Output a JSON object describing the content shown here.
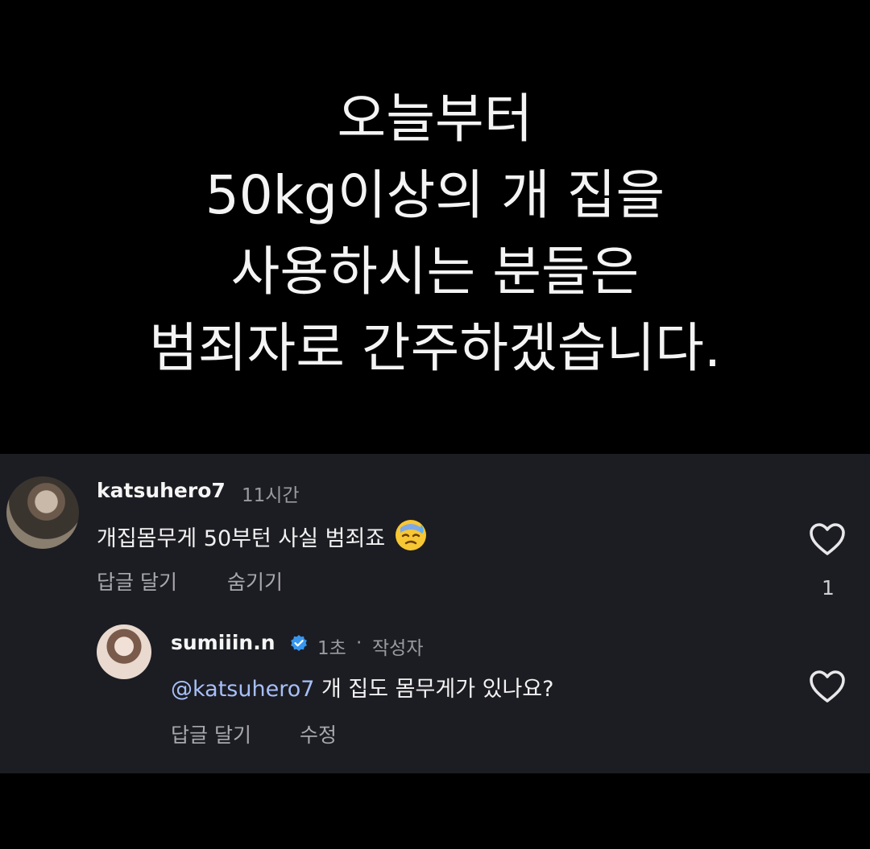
{
  "post": {
    "caption_lines": [
      "오늘부터",
      "50kg이상의 개 집을",
      "사용하시는 분들은",
      "범죄자로 간주하겠습니다."
    ]
  },
  "comments": [
    {
      "username": "katsuhero7",
      "time": "11시간",
      "text": "개집몸무게 50부턴 사실 범죄죠",
      "emoji": "downcast-sweat-face-emoji",
      "actions": {
        "reply": "답글 달기",
        "hide": "숨기기"
      },
      "like_count": "1"
    },
    {
      "username": "sumiiin.n",
      "verified": true,
      "time": "1초",
      "separator": "·",
      "author_tag": "작성자",
      "mention": "@katsuhero7",
      "text": "개 집도 몸무게가 있나요?",
      "actions": {
        "reply": "답글 달기",
        "edit": "수정"
      }
    }
  ],
  "colors": {
    "background": "#000000",
    "comment_panel": "#1c1d22",
    "mention": "#a7bff8",
    "verified_badge": "#3797f0",
    "muted_text": "#9a9ba1"
  }
}
